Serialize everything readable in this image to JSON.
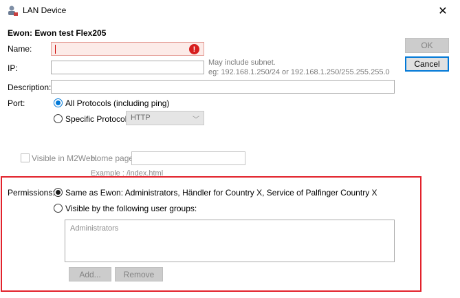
{
  "window": {
    "title": "LAN Device",
    "close_glyph": "✕"
  },
  "device": {
    "heading": "Ewon: Ewon test Flex205"
  },
  "form": {
    "name_label": "Name:",
    "name_value": "",
    "name_error_glyph": "!",
    "ip_label": "IP:",
    "ip_value": "",
    "ip_hint_line1": "May include subnet.",
    "ip_hint_line2": "eg: 192.168.1.250/24 or 192.168.1.250/255.255.255.0",
    "description_label": "Description:",
    "description_value": "",
    "port_label": "Port:",
    "port_all_label": "All Protocols (including ping)",
    "port_specific_label": "Specific Protocol:",
    "port_protocol_selected": "HTTP",
    "port_selected": "all"
  },
  "m2web": {
    "visible_label": "Visible in M2Web.",
    "visible_checked": false,
    "home_page_label": "Home page:",
    "home_page_value": "",
    "home_page_example": "Example : /index.html"
  },
  "permissions": {
    "label": "Permissions:",
    "same_as_ewon_label": "Same as Ewon: Administrators, Händler for Country X, Service of Palfinger Country X",
    "visible_groups_label": "Visible by the following user groups:",
    "selected": "same_as_ewon",
    "groups": [
      "Administrators"
    ],
    "add_label": "Add...",
    "remove_label": "Remove"
  },
  "buttons": {
    "ok_label": "OK",
    "cancel_label": "Cancel"
  },
  "colors": {
    "highlight_border": "#e2222b",
    "error_icon": "#d71e1e",
    "accent": "#0078d7"
  }
}
